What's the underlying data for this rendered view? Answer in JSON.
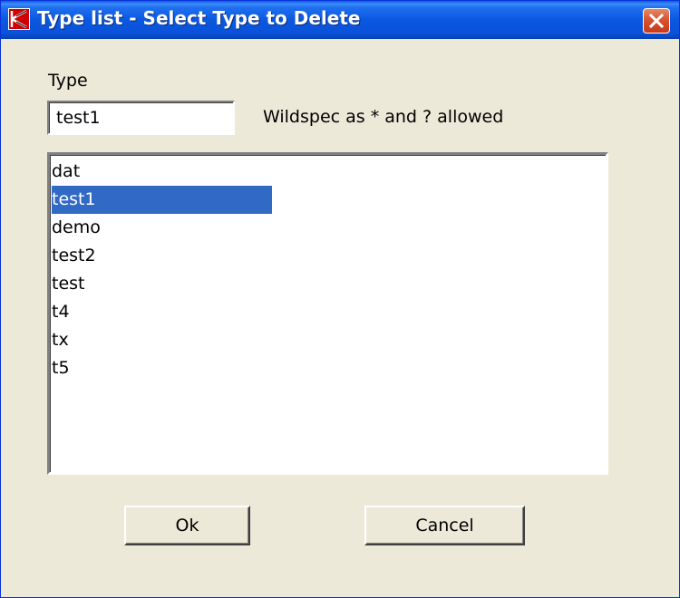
{
  "window": {
    "title": "Type list - Select Type to Delete",
    "app_icon": "app-logo-icon",
    "close_icon": "close-icon"
  },
  "form": {
    "type_label": "Type",
    "type_value": "test1",
    "hint": "Wildspec as * and ? allowed"
  },
  "list": {
    "items": [
      "dat",
      "test1",
      "demo",
      "test2",
      "test",
      "t4",
      "tx",
      "t5"
    ],
    "selected_index": 1
  },
  "buttons": {
    "ok_label": "Ok",
    "cancel_label": "Cancel"
  },
  "colors": {
    "selection": "#316ac5",
    "titlebar": "#0b58e0",
    "dialog_bg": "#ece9d8"
  }
}
